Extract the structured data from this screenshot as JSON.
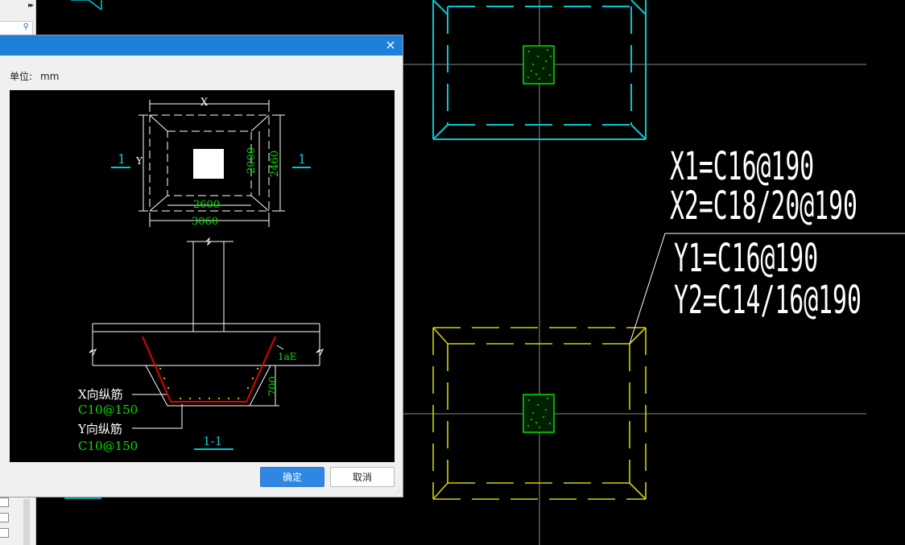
{
  "dialog": {
    "unit_label": "单位:",
    "unit_value": "mm",
    "ok_label": "确定",
    "cancel_label": "取消",
    "close_glyph": "×"
  },
  "preview": {
    "plan": {
      "dim_x_label": "X",
      "dim_y_label": "Y",
      "dim_inner_width": "2600",
      "dim_outer_width": "3060",
      "dim_inner_height": "2000",
      "dim_outer_height": "2460",
      "section_mark_left": "1",
      "section_mark_right": "1"
    },
    "section": {
      "anchor_label": "1aE",
      "depth_label": "700",
      "x_rebar_label": "X向纵筋",
      "x_rebar_value": "C10@150",
      "y_rebar_label": "Y向纵筋",
      "y_rebar_value": "C10@150",
      "section_title": "1-1"
    }
  },
  "drawing": {
    "annotations": [
      "X1=C16@190",
      "X2=C18/20@190",
      "Y1=C16@190",
      "Y2=C14/16@190"
    ]
  },
  "left_panel": {
    "expand_glyph": "▸▸",
    "search_icon_glyph": "⚲"
  },
  "colors": {
    "cyan": "#00c8d0",
    "yellow": "#d2d200",
    "green": "#00e000",
    "white": "#ffffff",
    "red": "#e00000",
    "titlebar": "#1e7fd9"
  }
}
